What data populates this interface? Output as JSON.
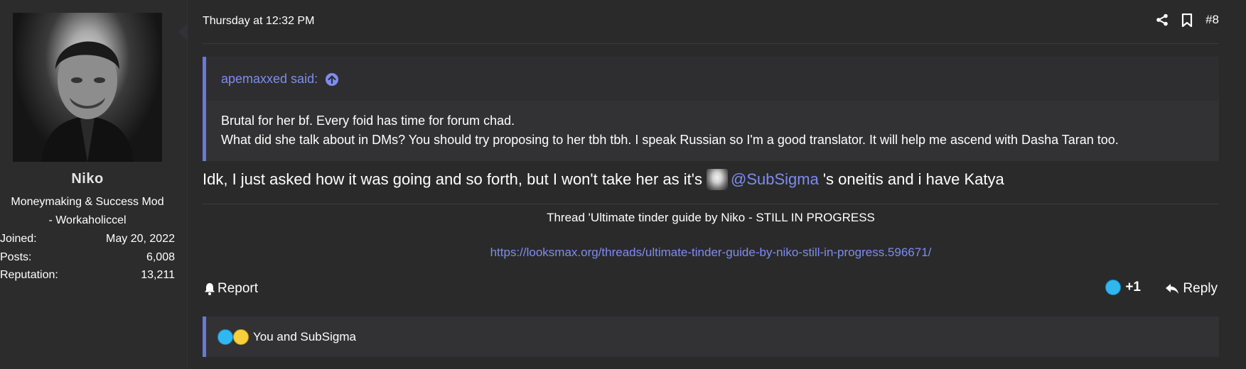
{
  "user": {
    "name": "Niko",
    "title_line1": "Moneymaking & Success Mod",
    "title_line2": "- Workaholiccel",
    "stats": [
      {
        "label": "Joined:",
        "value": "May 20, 2022"
      },
      {
        "label": "Posts:",
        "value": "6,008"
      },
      {
        "label": "Reputation:",
        "value": "13,211"
      }
    ]
  },
  "post": {
    "time": "Thursday at 12:32 PM",
    "number": "#8",
    "quote": {
      "author": "apemaxxed said:",
      "line1": "Brutal for her bf. Every foid has time for forum chad.",
      "line2": "What did she talk about in DMs? You should try proposing to her tbh tbh. I speak Russian so I'm a good translator. It will help me ascend with Dasha Taran too."
    },
    "message": {
      "before": "Idk, I just asked how it was going and so forth, but I won't take her as it's",
      "mention": "@SubSigma",
      "after": "'s oneitis and i have Katya"
    },
    "signature": {
      "title": "Thread 'Ultimate tinder guide by Niko - STILL IN PROGRESS",
      "link": "https://looksmax.org/threads/ultimate-tinder-guide-by-niko-still-in-progress.596671/"
    },
    "actions": {
      "report": "Report",
      "plus_one": "+1",
      "reply": "Reply"
    },
    "reactions_text": "You and SubSigma"
  },
  "colors": {
    "accent": "#7e8cf0",
    "quote_bar": "#6a78d6",
    "background": "#2a2a2b"
  }
}
